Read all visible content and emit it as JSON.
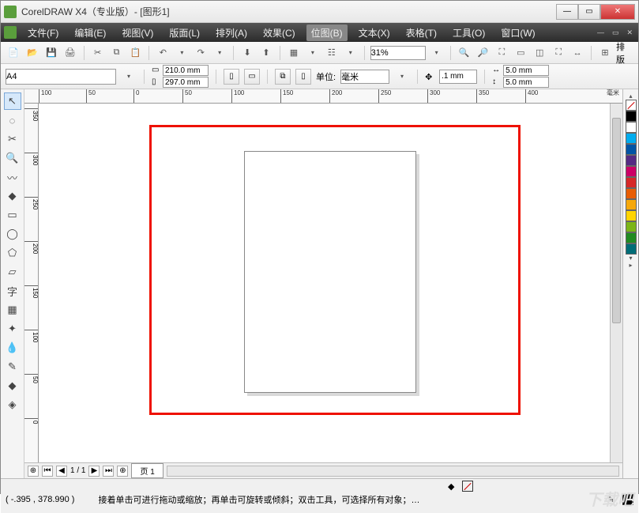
{
  "window": {
    "title": "CorelDRAW X4（专业版）- [图形1]"
  },
  "menu": {
    "items": [
      {
        "label": "文件(F)"
      },
      {
        "label": "编辑(E)"
      },
      {
        "label": "视图(V)"
      },
      {
        "label": "版面(L)"
      },
      {
        "label": "排列(A)"
      },
      {
        "label": "效果(C)"
      },
      {
        "label": "位图(B)",
        "active": true
      },
      {
        "label": "文本(X)"
      },
      {
        "label": "表格(T)"
      },
      {
        "label": "工具(O)"
      },
      {
        "label": "窗口(W)"
      }
    ]
  },
  "toolbar": {
    "zoom": "31%",
    "snap_label": "排版"
  },
  "props": {
    "paper": "A4",
    "width": "210.0 mm",
    "height": "297.0 mm",
    "units_label": "单位:",
    "units": "毫米",
    "nudge": ".1 mm",
    "dupx": "5.0 mm",
    "dupy": "5.0 mm"
  },
  "ruler": {
    "h": [
      "0",
      "50",
      "100",
      "150",
      "200",
      "250",
      "300",
      "350",
      "400"
    ],
    "h_neg": [
      "100",
      "50"
    ],
    "h_unit": "毫米",
    "v": [
      "350",
      "300",
      "250",
      "200",
      "150",
      "100",
      "50",
      "0"
    ]
  },
  "pager": {
    "pages": "1 / 1",
    "tab": "页 1"
  },
  "palette": [
    "#000000",
    "#ffffff",
    "#00acee",
    "#0055a5",
    "#552b84",
    "#cc0066",
    "#d62828",
    "#e85d04",
    "#f6a80b",
    "#ffd400",
    "#7cb518",
    "#228b22",
    "#006d77"
  ],
  "status": {
    "coords": "( -.395 , 378.990 )",
    "hint": "接着单击可进行拖动或缩放；再单击可旋转或倾斜；双击工具，可选择所有对象；…"
  }
}
